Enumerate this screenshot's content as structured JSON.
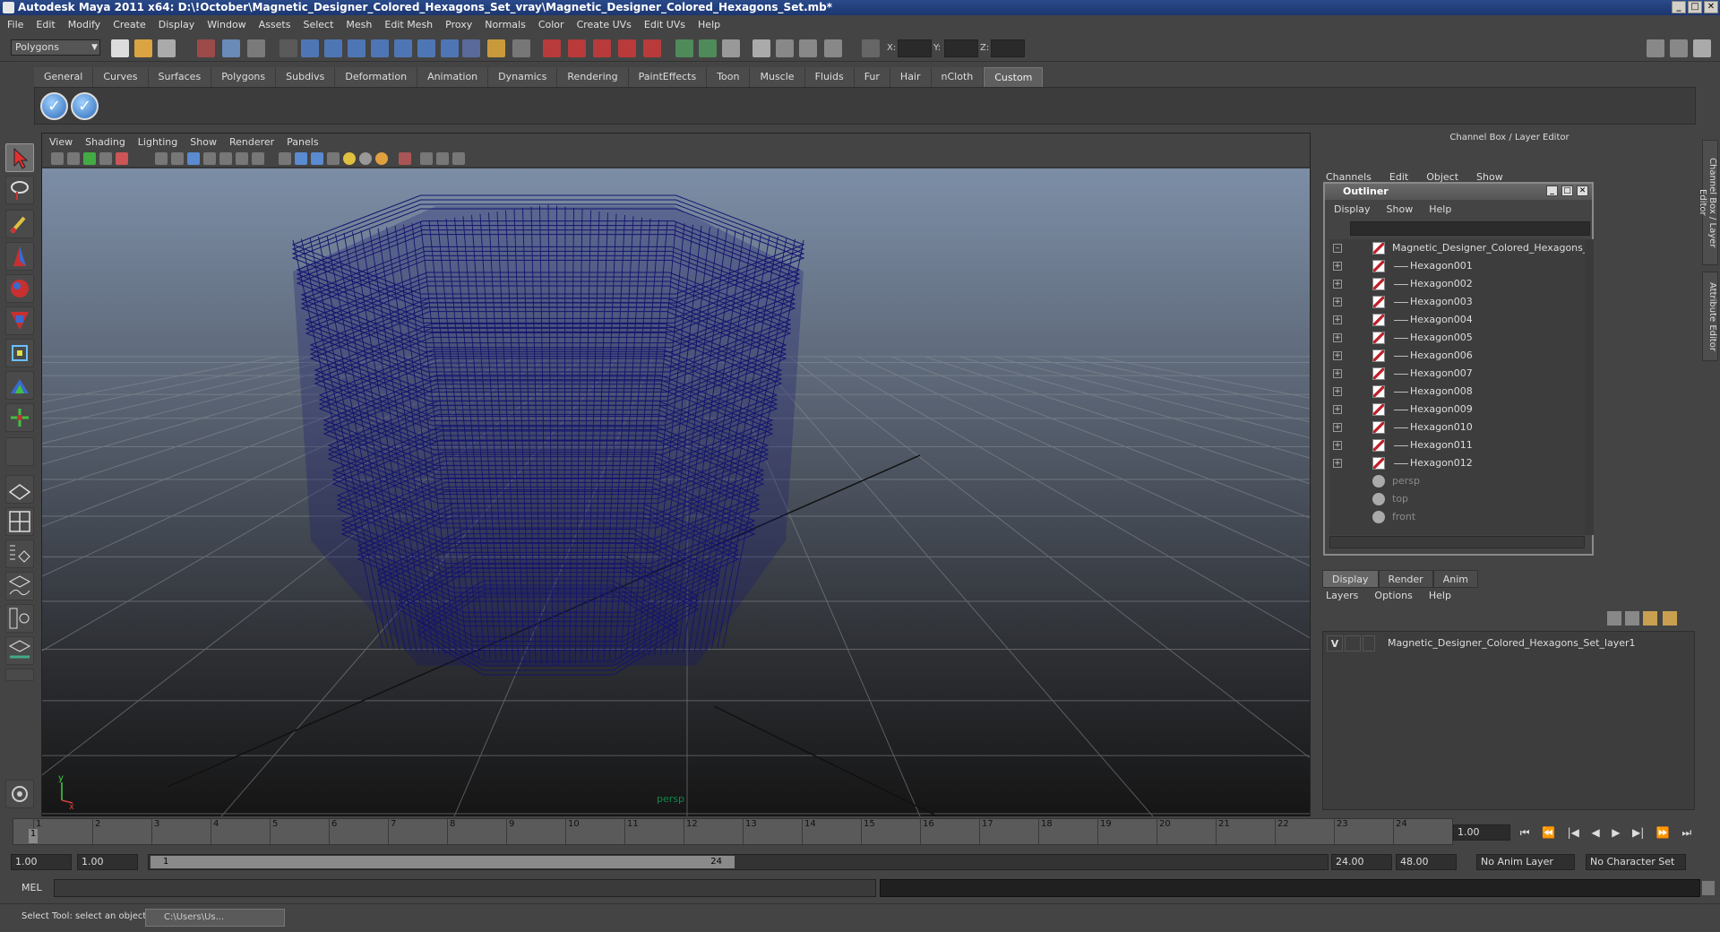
{
  "window": {
    "title": "Autodesk Maya 2011 x64: D:\\!October\\Magnetic_Designer_Colored_Hexagons_Set_vray\\Magnetic_Designer_Colored_Hexagons_Set.mb*",
    "controls": [
      "_",
      "□",
      "✕"
    ]
  },
  "menubar": [
    "File",
    "Edit",
    "Modify",
    "Create",
    "Display",
    "Window",
    "Assets",
    "Select",
    "Mesh",
    "Edit Mesh",
    "Proxy",
    "Normals",
    "Color",
    "Create UVs",
    "Edit UVs",
    "Help"
  ],
  "statusline": {
    "mode": "Polygons",
    "x_label": "X:",
    "y_label": "Y:",
    "z_label": "Z:"
  },
  "shelf": {
    "tabs": [
      "General",
      "Curves",
      "Surfaces",
      "Polygons",
      "Subdivs",
      "Deformation",
      "Animation",
      "Dynamics",
      "Rendering",
      "PaintEffects",
      "Toon",
      "Muscle",
      "Fluids",
      "Fur",
      "Hair",
      "nCloth",
      "Custom"
    ],
    "active_tab": "Custom",
    "buttons": [
      "✓",
      "✓"
    ]
  },
  "viewport": {
    "menu": [
      "View",
      "Shading",
      "Lighting",
      "Show",
      "Renderer",
      "Panels"
    ],
    "camera_label": "persp",
    "wire_color": "#14146e",
    "axis_y": "y",
    "axis_x": "x"
  },
  "channelbox": {
    "header": "Channel Box / Layer Editor",
    "menu": [
      "Channels",
      "Edit",
      "Object",
      "Show"
    ],
    "side_tabs": [
      "Channel Box / Layer Editor",
      "Attribute Editor"
    ]
  },
  "outliner": {
    "title": "Outliner",
    "menu": [
      "Display",
      "Show",
      "Help"
    ],
    "root": "Magnetic_Designer_Colored_Hexagons_Se",
    "items": [
      "Hexagon001",
      "Hexagon002",
      "Hexagon003",
      "Hexagon004",
      "Hexagon005",
      "Hexagon006",
      "Hexagon007",
      "Hexagon008",
      "Hexagon009",
      "Hexagon010",
      "Hexagon011",
      "Hexagon012"
    ],
    "cameras": [
      "persp",
      "top",
      "front"
    ]
  },
  "layer_editor": {
    "tabs": [
      "Display",
      "Render",
      "Anim"
    ],
    "menu": [
      "Layers",
      "Options",
      "Help"
    ],
    "layer": {
      "visible": "V",
      "name": "Magnetic_Designer_Colored_Hexagons_Set_layer1"
    }
  },
  "timeline": {
    "frames": [
      "1",
      "2",
      "3",
      "4",
      "5",
      "6",
      "7",
      "8",
      "9",
      "10",
      "11",
      "12",
      "13",
      "14",
      "15",
      "16",
      "17",
      "18",
      "19",
      "20",
      "21",
      "22",
      "23",
      "24"
    ],
    "current_frame": "1",
    "current_time": "1.00",
    "play_controls": [
      "⏮",
      "⏪",
      "|◀",
      "◀",
      "▶",
      "▶|",
      "⏩",
      "⏭"
    ]
  },
  "range": {
    "start": "1.00",
    "start_inner": "1.00",
    "handle_start": "1",
    "handle_end": "24",
    "end_inner": "24.00",
    "end": "48.00",
    "anim_layer": "No Anim Layer",
    "character_set": "No Character Set"
  },
  "commandline": {
    "label": "MEL"
  },
  "helpline": {
    "text": "Select Tool: select an object",
    "task": "C:\\Users\\Us..."
  }
}
